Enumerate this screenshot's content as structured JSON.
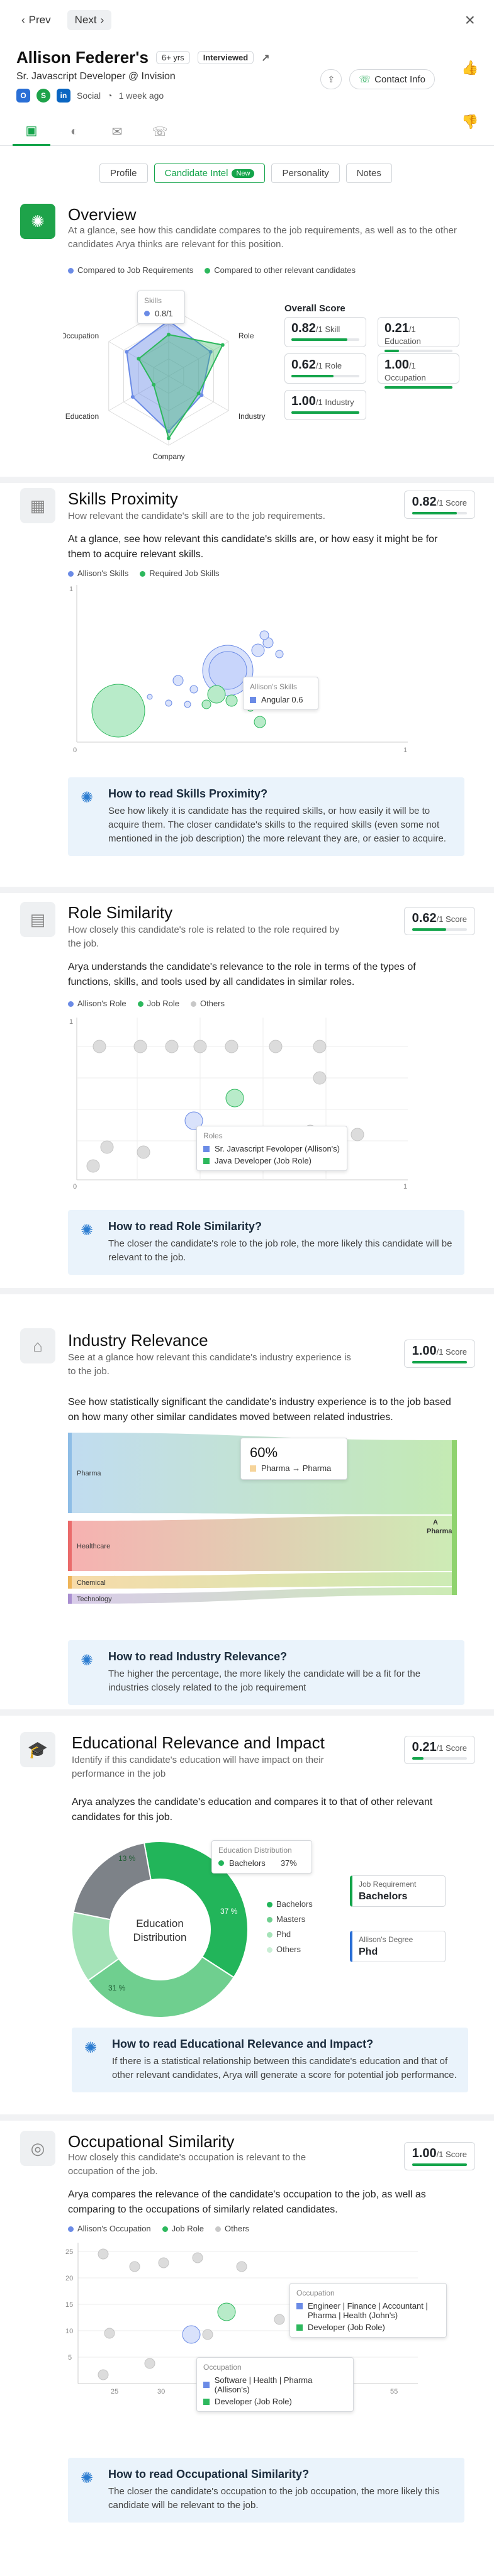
{
  "nav": {
    "prev": "Prev",
    "next": "Next"
  },
  "candidate": {
    "name": "Allison Federer's",
    "experience": "6+ yrs",
    "status": "Interviewed",
    "title": "Sr. Javascript Developer @ Invision",
    "source": "Social",
    "updated": "1 week ago",
    "contact_label": "Contact Info"
  },
  "subtabs": [
    {
      "label": "Profile"
    },
    {
      "label": "Candidate Intel",
      "badge": "New"
    },
    {
      "label": "Personality"
    },
    {
      "label": "Notes"
    }
  ],
  "overview": {
    "title": "Overview",
    "desc": "At a glance, see how this candidate compares to the job requirements, as well as to the other candidates Arya thinks are relevant for this position.",
    "legend": [
      "Compared to Job Requirements",
      "Compared to other relevant candidates"
    ],
    "tooltip": {
      "title": "Skills",
      "value": "0.8/1"
    },
    "score_heading": "Overall Score",
    "scores": [
      {
        "value": "0.82",
        "label": "/1 Skill",
        "fill": 0.82
      },
      {
        "value": "0.21",
        "label": "/1 Education",
        "fill": 0.21
      },
      {
        "value": "0.62",
        "label": "/1 Role",
        "fill": 0.62
      },
      {
        "value": "1.00",
        "label": "/1 Occupation",
        "fill": 1.0
      },
      {
        "value": "1.00",
        "label": "/1 Industry",
        "fill": 1.0
      }
    ]
  },
  "skills": {
    "title": "Skills Proximity",
    "desc": "How relevant the candidate's skill are to the job requirements.",
    "score": "0.82",
    "score_label": "/1 Score",
    "fill": 0.82,
    "body": "At a glance, see how relevant this candidate's skills are, or how easy it might be for them to acquire relevant skills.",
    "legend": [
      "Allison's Skills",
      "Required Job Skills"
    ],
    "axis": {
      "y_top": "1",
      "origin": "0",
      "x_end": "1"
    },
    "tooltip": {
      "title": "Allison's Skills",
      "item": "Angular 0.6"
    },
    "info_title": "How to read Skills Proximity?",
    "info_text": "See how likely it is candidate has the required skills, or how easily it will be to acquire them. The closer candidate's skills to the required skills (even some not mentioned in the job description) the more relevant they are, or easier to acquire."
  },
  "role": {
    "title": "Role Similarity",
    "desc": "How closely this candidate's role is related to the role required by the job.",
    "score": "0.62",
    "score_label": "/1 Score",
    "fill": 0.62,
    "body": "Arya understands the candidate's relevance to the role in terms of the types of functions, skills, and tools used by all candidates in similar roles.",
    "legend": [
      "Allison's Role",
      "Job Role",
      "Others"
    ],
    "axis": {
      "y_top": "1",
      "origin": "0",
      "x_end": "1"
    },
    "tooltip": {
      "title": "Roles",
      "items": [
        "Sr. Javascript Fevoloper (Allison's)",
        "Java Developer (Job Role)"
      ]
    },
    "info_title": "How to read Role Similarity?",
    "info_text": "The closer the candidate's role to the job role, the more likely this candidate will be relevant to the job."
  },
  "industry": {
    "title": "Industry Relevance",
    "desc": "See at a glance how relevant this candidate's industry experience is to the job.",
    "score": "1.00",
    "score_label": "/1 Score",
    "fill": 1.0,
    "body": "See how statistically significant the candidate's industry experience is to the job based on how many other similar candidates moved between related industries.",
    "flows": [
      "Pharma",
      "Healthcare",
      "Chemical",
      "Technology"
    ],
    "target": "Pharma",
    "tooltip": {
      "percent": "60%",
      "label": "Pharma → Pharma"
    },
    "info_title": "How to read Industry Relevance?",
    "info_text": "The higher the percentage, the more likely the candidate will be a fit for the industries closely related to the job requirement"
  },
  "education": {
    "title": "Educational Relevance and Impact",
    "desc": "Identify if this candidate's education will have impact on their performance in the job",
    "score": "0.21",
    "score_label": "/1 Score",
    "fill": 0.21,
    "body": "Arya analyzes the candidate's education and compares it to that of other relevant candidates for this job.",
    "center_label": "Education Distribution",
    "slices": [
      {
        "name": "Bachelors",
        "value": 37,
        "color": "#22b55a"
      },
      {
        "name": "Masters",
        "value": 31,
        "color": "#6fcf8f"
      },
      {
        "name": "Phd",
        "value": 13,
        "color": "#a5e3b8"
      },
      {
        "name": "Others",
        "value": 19,
        "color": "#c9eed5"
      }
    ],
    "slice_labels": [
      "37 %",
      "31 %",
      "13 %"
    ],
    "tooltip": {
      "title": "Education Distribution",
      "item": "Bachelors",
      "value": "37%"
    },
    "requirement_label": "Job Requirement",
    "requirement_value": "Bachelors",
    "degree_label": "Allison's Degree",
    "degree_value": "Phd",
    "info_title": "How to read Educational Relevance and Impact?",
    "info_text": "If there is a statistical relationship between this candidate's education and that of other relevant candidates, Arya will generate a score for potential job performance."
  },
  "occupation": {
    "title": "Occupational Similarity",
    "desc": "How closely this candidate's occupation is relevant to the occupation of the job.",
    "score": "1.00",
    "score_label": "/1 Score",
    "fill": 1.0,
    "body": "Arya compares the relevance of the candidate's occupation to the job, as well as comparing to the occupations of similarly related candidates.",
    "legend": [
      "Allison's Occupation",
      "Job Role",
      "Others"
    ],
    "y_ticks": [
      "25",
      "20",
      "15",
      "10",
      "5"
    ],
    "x_ticks": [
      "25",
      "30",
      "35",
      "40",
      "45",
      "50",
      "55"
    ],
    "tooltip1": {
      "title": "Occupation",
      "items": [
        "Engineer | Finance | Accountant | Pharma | Health (John's)",
        "Developer (Job Role)"
      ]
    },
    "tooltip2": {
      "title": "Occupation",
      "items": [
        "Software | Health | Pharma (Allison's)",
        "Developer (Job Role)"
      ]
    },
    "info_title": "How to read Occupational Similarity?",
    "info_text": "The closer the candidate's occupation to the job occupation, the more likely this candidate will be relevant to the job."
  },
  "chart_data": [
    {
      "type": "radar",
      "categories": [
        "Skills",
        "Role",
        "Industry",
        "Company",
        "Education",
        "Occupation"
      ],
      "series": [
        {
          "name": "Compared to Job Requirements",
          "values": [
            0.8,
            0.7,
            0.55,
            0.8,
            0.6,
            0.7
          ]
        },
        {
          "name": "Compared to other relevant candidates",
          "values": [
            0.6,
            0.9,
            0.5,
            0.9,
            0.25,
            0.5
          ]
        }
      ]
    },
    {
      "type": "pie",
      "categories": [
        "Bachelors",
        "Masters",
        "Phd",
        "Others"
      ],
      "values": [
        37,
        31,
        13,
        19
      ]
    }
  ]
}
